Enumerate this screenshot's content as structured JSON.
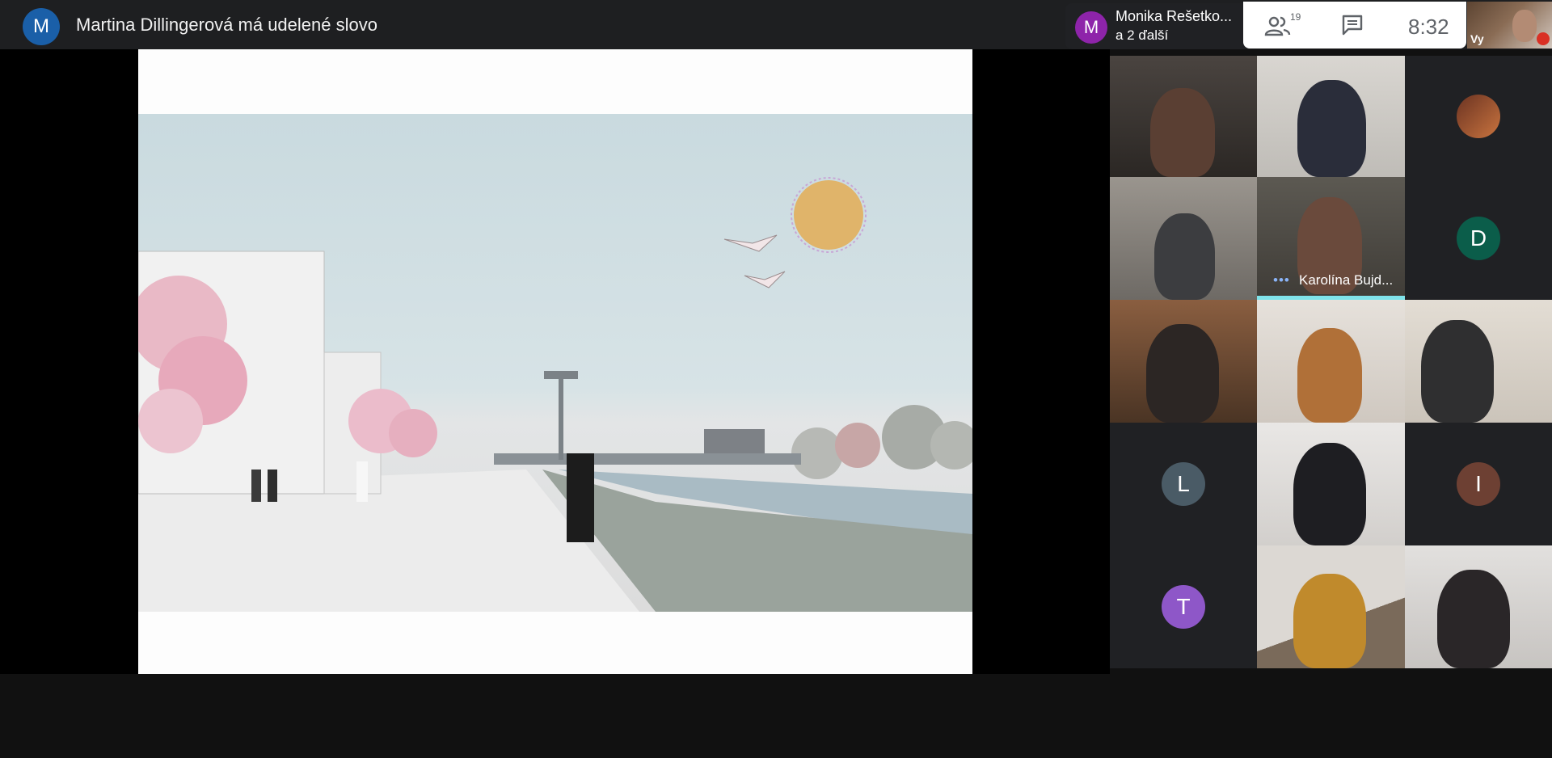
{
  "topbar": {
    "presenter_initial": "M",
    "presenter_title": "Martina Dillingerová má udelené slovo"
  },
  "active_speaker": {
    "initial": "M",
    "name": "Monika Rešetko...",
    "others": "a 2 ďalší"
  },
  "panel": {
    "people_count": "19",
    "time": "8:32"
  },
  "self_view": {
    "label": "Vy"
  },
  "tiles": [
    {
      "type": "video",
      "name": ""
    },
    {
      "type": "video",
      "name": ""
    },
    {
      "type": "avatar",
      "initial": "",
      "image": true
    },
    {
      "type": "video",
      "name": ""
    },
    {
      "type": "video",
      "name": "Karolína Bujd..."
    },
    {
      "type": "avatar",
      "initial": "D",
      "color": "#0b5d4a"
    },
    {
      "type": "video",
      "name": ""
    },
    {
      "type": "video",
      "name": ""
    },
    {
      "type": "video",
      "name": ""
    },
    {
      "type": "avatar",
      "initial": "L",
      "color": "#4a5b66"
    },
    {
      "type": "video",
      "name": ""
    },
    {
      "type": "avatar",
      "initial": "I",
      "color": "#6d4033"
    },
    {
      "type": "avatar",
      "initial": "T",
      "color": "#8e57c8"
    },
    {
      "type": "video",
      "name": ""
    },
    {
      "type": "video",
      "name": ""
    }
  ],
  "colors": {
    "speaking_indicator": "#7fe3ea",
    "background": "#111111",
    "mic_off": "#d93025"
  }
}
